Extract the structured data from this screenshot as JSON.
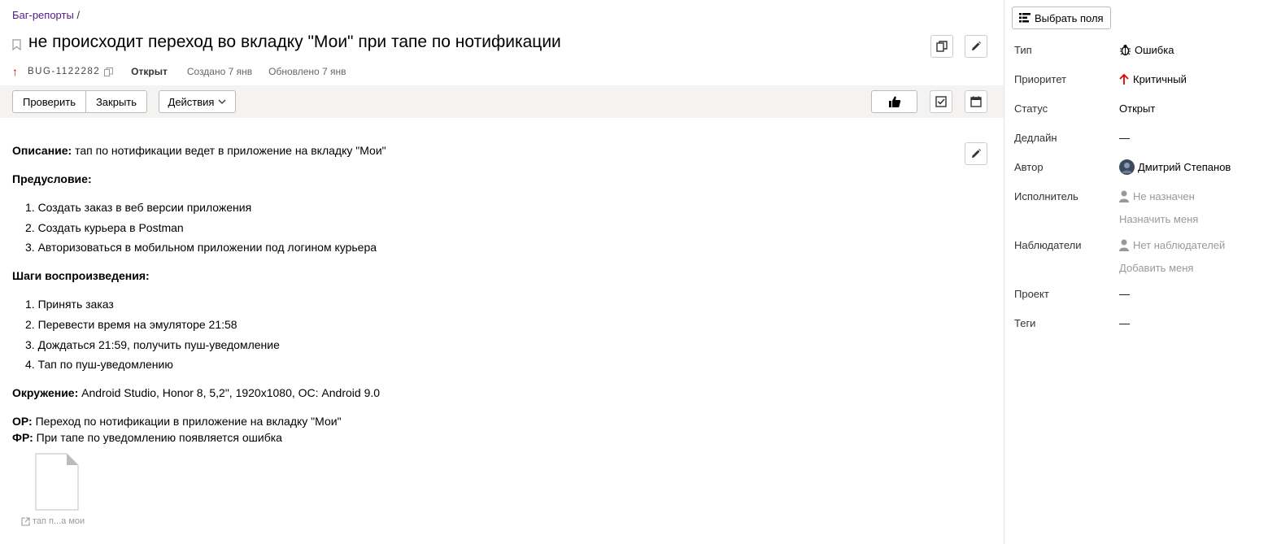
{
  "breadcrumb": {
    "link": "Баг-репорты",
    "separator": "/"
  },
  "issue": {
    "title": "не происходит переход во вкладку \"Мои\" при тапе по нотификации",
    "key": "BUG-1122282",
    "status": "Открыт",
    "created": "Создано 7 янв",
    "updated": "Обновлено 7 янв"
  },
  "toolbar": {
    "check_label": "Проверить",
    "close_label": "Закрыть",
    "actions_label": "Действия"
  },
  "description": {
    "desc_label": "Описание:",
    "desc_text": "тап по нотификации ведет в приложение на вкладку \"Мои\"",
    "precondition_label": "Предусловие:",
    "preconditions": [
      "1. Создать заказ в веб версии приложения",
      "2. Создать курьера в Postman",
      "3. Авторизоваться в мобильном приложении под логином курьера"
    ],
    "steps_label": "Шаги воспроизведения:",
    "steps": [
      "1. Принять заказ",
      "2. Перевести время на эмуляторе 21:58",
      "3. Дождаться 21:59, получить пуш-уведомление",
      "4. Тап по пуш-уведомлению"
    ],
    "env_label": "Окружение:",
    "env_text": "Android Studio, Honor 8, 5,2\", 1920x1080, ОС: Android 9.0",
    "expected_label": "ОР:",
    "expected_text": "Переход по нотификации в приложение на вкладку \"Мои\"",
    "actual_label": "ФР:",
    "actual_text": "При тапе по уведомлению появляется ошибка",
    "attachment_name": "тап п...а мои"
  },
  "sidebar": {
    "select_fields_label": "Выбрать поля",
    "fields": {
      "type_label": "Тип",
      "type_value": "Ошибка",
      "priority_label": "Приоритет",
      "priority_value": "Критичный",
      "status_label": "Статус",
      "status_value": "Открыт",
      "deadline_label": "Дедлайн",
      "deadline_value": "—",
      "author_label": "Автор",
      "author_value": "Дмитрий Степанов",
      "assignee_label": "Исполнитель",
      "assignee_value": "Не назначен",
      "assign_me": "Назначить меня",
      "watchers_label": "Наблюдатели",
      "watchers_value": "Нет наблюдателей",
      "add_me": "Добавить меня",
      "project_label": "Проект",
      "project_value": "—",
      "tags_label": "Теги",
      "tags_value": "—"
    }
  },
  "colors": {
    "priority_red": "#e00000",
    "toolbar_bg": "#f4f3f2",
    "link_purple": "#551a8b"
  }
}
